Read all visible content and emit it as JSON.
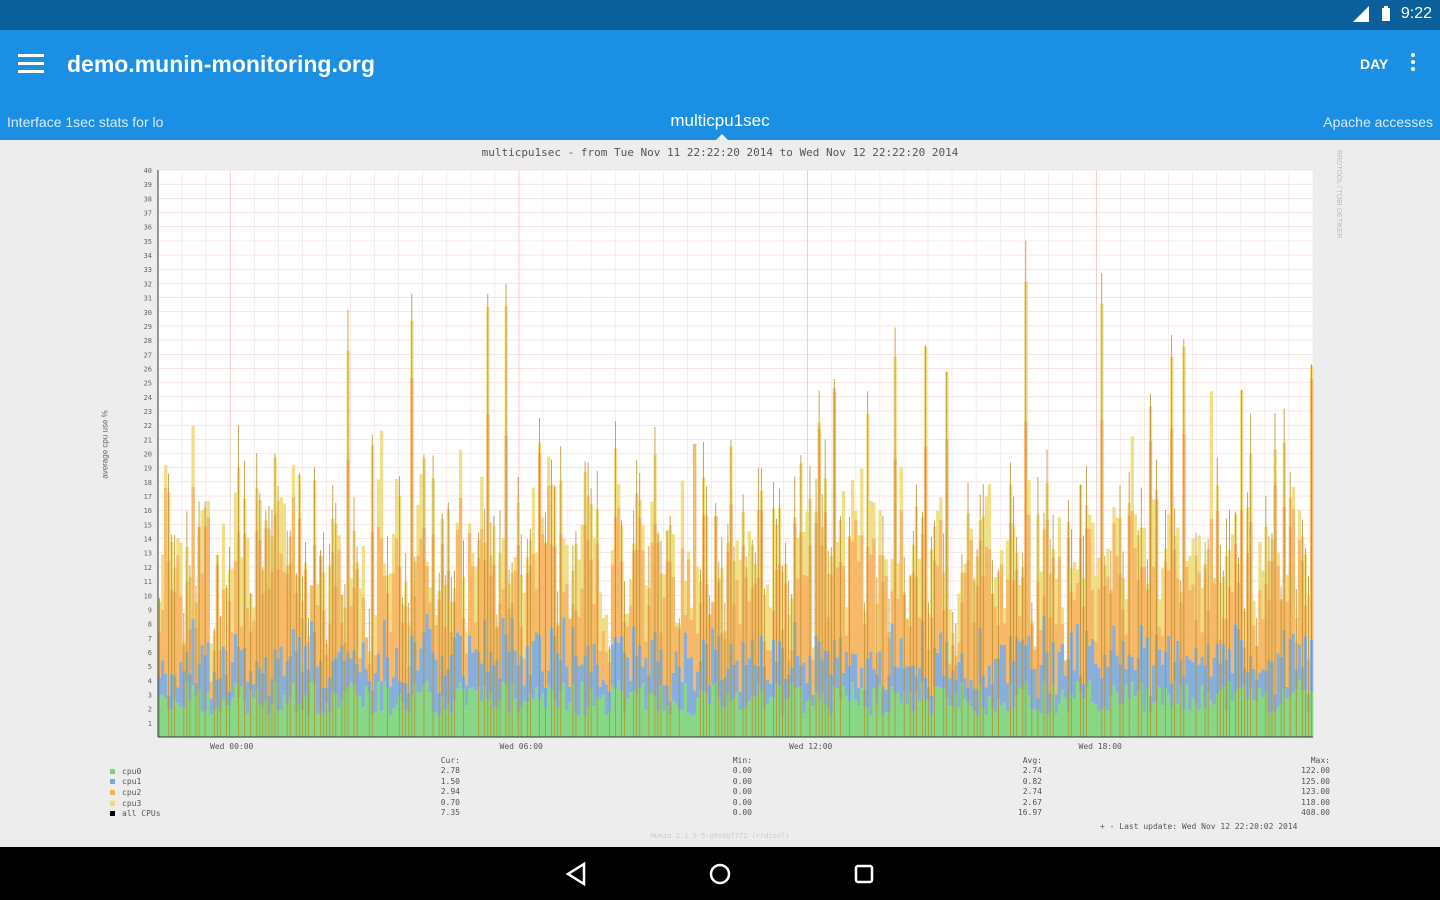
{
  "status": {
    "time": "9:22"
  },
  "appbar": {
    "title": "demo.munin-monitoring.org",
    "range_button": "DAY"
  },
  "tabs": {
    "prev": "Interface 1sec stats for lo",
    "current": "multicpu1sec",
    "next": "Apache accesses"
  },
  "graph": {
    "title": "multicpu1sec - from Tue Nov 11 22:22:20 2014 to Wed Nov 12 22:22:20 2014",
    "side_note": "RRDTOOL / TOBI OETIKER",
    "credits": "Munin 2.1.9-5-g9e6bf7f2 (rrdtool)",
    "last_update": "Last update: Wed Nov 12 22:20:02 2014"
  },
  "chart_data": {
    "type": "area",
    "title": "multicpu1sec - from Tue Nov 11 22:22:20 2014 to Wed Nov 12 22:22:20 2014",
    "ylabel": "average cpu use %",
    "ylim": [
      0,
      40
    ],
    "y_ticks": [
      "1",
      "2",
      "3",
      "4",
      "5",
      "6",
      "7",
      "8",
      "9",
      "10",
      "11",
      "12",
      "13",
      "14",
      "15",
      "16",
      "17",
      "18",
      "19",
      "20",
      "21",
      "22",
      "23",
      "24",
      "25",
      "26",
      "27",
      "28",
      "29",
      "30",
      "31",
      "32",
      "33",
      "34",
      "35",
      "36",
      "37",
      "38",
      "39",
      "40"
    ],
    "x_ticks": [
      "Wed 00:00",
      "Wed 06:00",
      "Wed 12:00",
      "Wed 18:00"
    ],
    "stacked": true,
    "series": [
      {
        "name": "cpu0",
        "color": "#7bd47b"
      },
      {
        "name": "cpu1",
        "color": "#7ca7d9"
      },
      {
        "name": "cpu2",
        "color": "#f5b25a"
      },
      {
        "name": "cpu3",
        "color": "#f0dc7a"
      },
      {
        "name": "all CPUs",
        "color": "#000000"
      }
    ],
    "legend_columns": [
      "Cur:",
      "Min:",
      "Avg:",
      "Max:"
    ],
    "legend_values": [
      [
        "2.78",
        "0.00",
        "2.74",
        "122.00"
      ],
      [
        "1.50",
        "0.00",
        "0.82",
        "125.00"
      ],
      [
        "2.94",
        "0.00",
        "2.74",
        "123.00"
      ],
      [
        "0.70",
        "0.00",
        "2.67",
        "118.00"
      ],
      [
        "7.35",
        "0.00",
        "16.97",
        "408.00"
      ]
    ]
  }
}
